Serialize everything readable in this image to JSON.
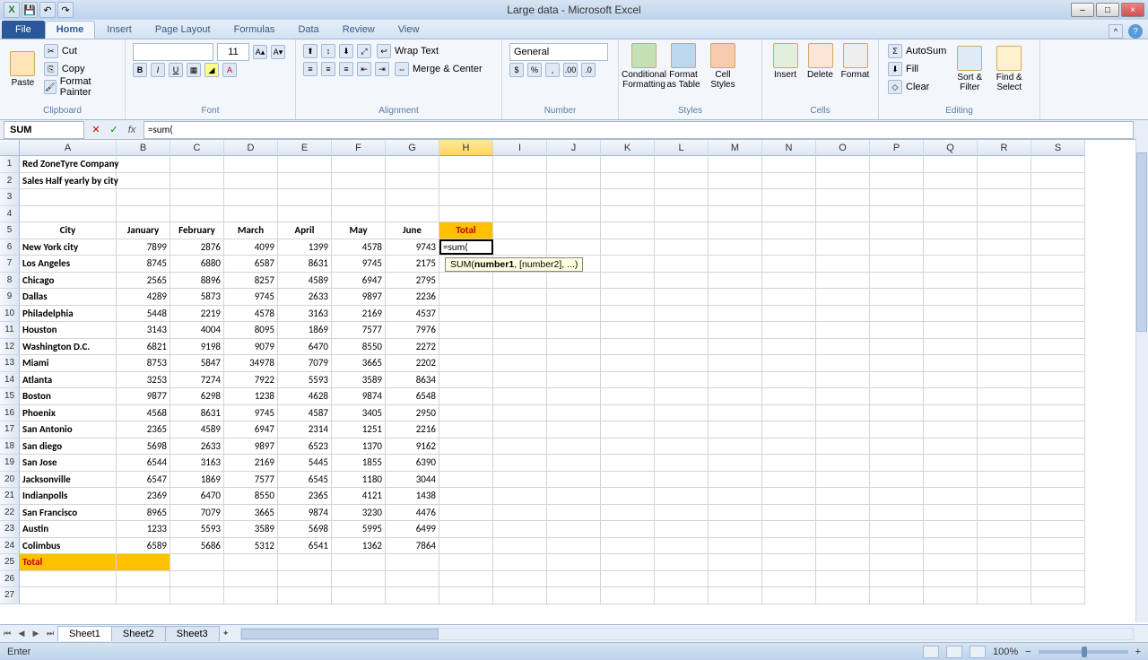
{
  "window": {
    "title": "Large data - Microsoft Excel",
    "min": "–",
    "max": "□",
    "close": "×"
  },
  "tabs": {
    "file": "File",
    "home": "Home",
    "insert": "Insert",
    "pagelayout": "Page Layout",
    "formulas": "Formulas",
    "data": "Data",
    "review": "Review",
    "view": "View"
  },
  "ribbon": {
    "clipboard": {
      "label": "Clipboard",
      "paste": "Paste",
      "cut": "Cut",
      "copy": "Copy",
      "fp": "Format Painter"
    },
    "font": {
      "label": "Font",
      "size": "11",
      "B": "B",
      "I": "I",
      "U": "U"
    },
    "alignment": {
      "label": "Alignment",
      "wrap": "Wrap Text",
      "merge": "Merge & Center"
    },
    "number": {
      "label": "Number",
      "format": "General",
      "cur": "$",
      "pct": "%",
      "comma": ","
    },
    "styles": {
      "label": "Styles",
      "cond": "Conditional Formatting",
      "table": "Format as Table",
      "cell": "Cell Styles"
    },
    "cells": {
      "label": "Cells",
      "insert": "Insert",
      "delete": "Delete",
      "format": "Format"
    },
    "editing": {
      "label": "Editing",
      "autosum": "AutoSum",
      "fill": "Fill",
      "clear": "Clear",
      "sort": "Sort & Filter",
      "find": "Find & Select"
    }
  },
  "namebox": "SUM",
  "formula": "=sum(",
  "columns": [
    "A",
    "B",
    "C",
    "D",
    "E",
    "F",
    "G",
    "H",
    "I",
    "J",
    "K",
    "L",
    "M",
    "N",
    "O",
    "P",
    "Q",
    "R",
    "S"
  ],
  "active_col": "H",
  "title_rows": {
    "r1": "Red ZoneTyre Company",
    "r2": "Sales Half yearly by city"
  },
  "headers": [
    "City",
    "January",
    "February",
    "March",
    "April",
    "May",
    "June",
    "Total"
  ],
  "total_label": "Total",
  "rows": [
    {
      "n": 6,
      "city": "New York city",
      "v": [
        7899,
        2876,
        4099,
        1399,
        4578,
        9743
      ]
    },
    {
      "n": 7,
      "city": "Los Angeles",
      "v": [
        8745,
        6880,
        6587,
        8631,
        9745,
        2175
      ]
    },
    {
      "n": 8,
      "city": "Chicago",
      "v": [
        2565,
        8896,
        8257,
        4589,
        6947,
        2795
      ]
    },
    {
      "n": 9,
      "city": "Dallas",
      "v": [
        4289,
        5873,
        9745,
        2633,
        9897,
        2236
      ]
    },
    {
      "n": 10,
      "city": "Philadelphia",
      "v": [
        5448,
        2219,
        4578,
        3163,
        2169,
        4537
      ]
    },
    {
      "n": 11,
      "city": "Houston",
      "v": [
        3143,
        4004,
        8095,
        1869,
        7577,
        7976
      ]
    },
    {
      "n": 12,
      "city": "Washington D.C.",
      "v": [
        6821,
        9198,
        9079,
        6470,
        8550,
        2272
      ]
    },
    {
      "n": 13,
      "city": "Miami",
      "v": [
        8753,
        5847,
        34978,
        7079,
        3665,
        2202
      ]
    },
    {
      "n": 14,
      "city": "Atlanta",
      "v": [
        3253,
        7274,
        7922,
        5593,
        3589,
        8634
      ]
    },
    {
      "n": 15,
      "city": "Boston",
      "v": [
        9877,
        6298,
        1238,
        4628,
        9874,
        6548
      ]
    },
    {
      "n": 16,
      "city": "Phoenix",
      "v": [
        4568,
        8631,
        9745,
        4587,
        3405,
        2950
      ]
    },
    {
      "n": 17,
      "city": "San Antonio",
      "v": [
        2365,
        4589,
        6947,
        2314,
        1251,
        2216
      ]
    },
    {
      "n": 18,
      "city": "San diego",
      "v": [
        5698,
        2633,
        9897,
        6523,
        1370,
        9162
      ]
    },
    {
      "n": 19,
      "city": "San Jose",
      "v": [
        6544,
        3163,
        2169,
        5445,
        1855,
        6390
      ]
    },
    {
      "n": 20,
      "city": "Jacksonville",
      "v": [
        6547,
        1869,
        7577,
        6545,
        1180,
        3044
      ]
    },
    {
      "n": 21,
      "city": "Indianpolls",
      "v": [
        2369,
        6470,
        8550,
        2365,
        4121,
        1438
      ]
    },
    {
      "n": 22,
      "city": "San Francisco",
      "v": [
        8965,
        7079,
        3665,
        9874,
        3230,
        4476
      ]
    },
    {
      "n": 23,
      "city": "Austin",
      "v": [
        1233,
        5593,
        3589,
        5698,
        5995,
        6499
      ]
    },
    {
      "n": 24,
      "city": "Colimbus",
      "v": [
        6589,
        5686,
        5312,
        6541,
        1362,
        7864
      ]
    }
  ],
  "edit": {
    "value": "=sum(",
    "tooltip_pre": "SUM(",
    "tooltip_bold": "number1",
    "tooltip_post": ", [number2], ...)"
  },
  "sheets": {
    "s1": "Sheet1",
    "s2": "Sheet2",
    "s3": "Sheet3"
  },
  "status": {
    "mode": "Enter",
    "zoom": "100%"
  }
}
